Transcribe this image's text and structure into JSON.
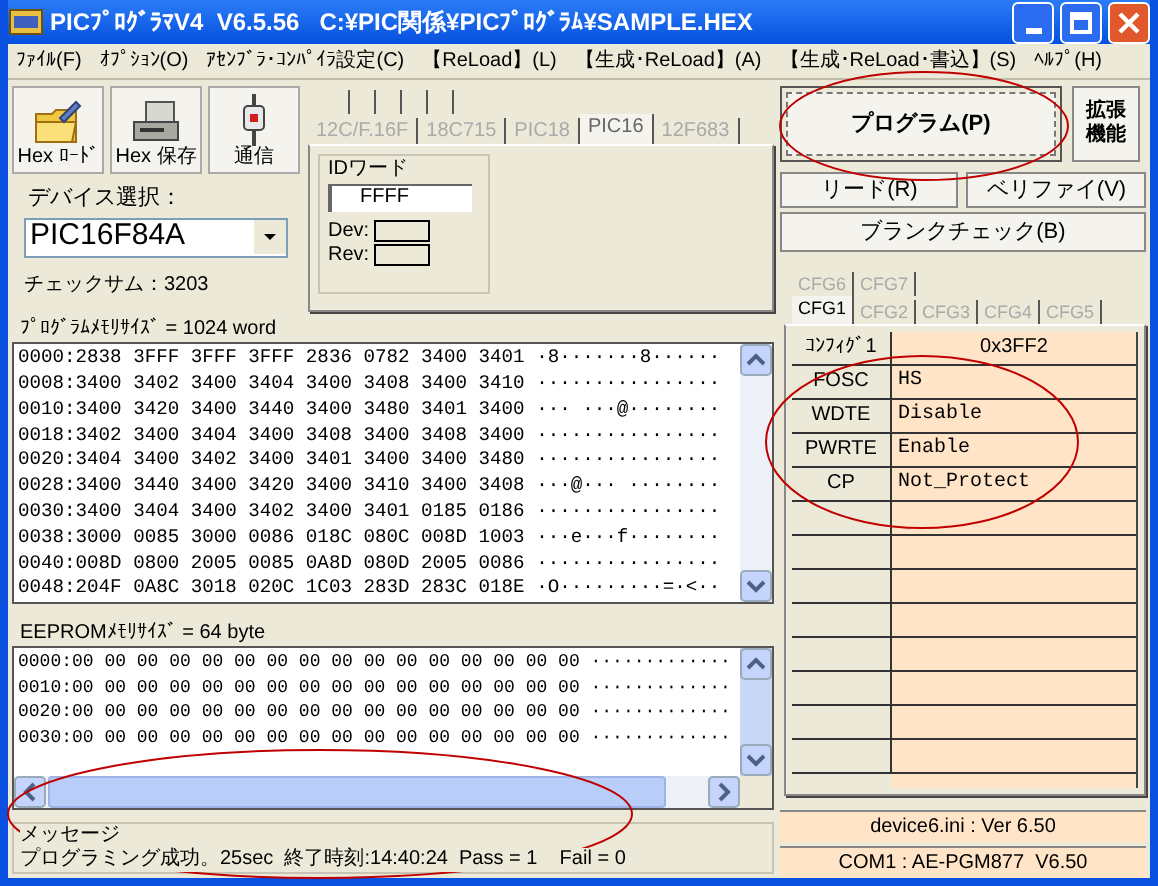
{
  "window": {
    "title": "PICﾌﾟﾛｸﾞﾗﾏV4  V6.5.56   C:¥PIC関係¥PICﾌﾟﾛｸﾞﾗﾑ¥SAMPLE.HEX"
  },
  "menu": [
    "ﾌｧｲﾙ(F)",
    "ｵﾌﾟｼｮﾝ(O)",
    "ｱｾﾝﾌﾞﾗ･ｺﾝﾊﾟｲﾗ設定(C)",
    "【ReLoad】(L)",
    "【生成･ReLoad】(A)",
    "【生成･ReLoad･書込】(S)",
    "ﾍﾙﾌﾟ(H)"
  ],
  "toolbar": [
    {
      "kind": "folder",
      "label": "Hex ﾛｰﾄﾞ"
    },
    {
      "kind": "drive",
      "label": "Hex 保存"
    },
    {
      "kind": "plug",
      "label": "通信"
    }
  ],
  "device_tabs": [
    {
      "label": "12C/F.16F",
      "selected": false
    },
    {
      "label": "18C715",
      "selected": false
    },
    {
      "label": "PIC18",
      "selected": false
    },
    {
      "label": "PIC16",
      "selected": true
    },
    {
      "label": "12F683",
      "selected": false
    }
  ],
  "id_word": {
    "label": "IDワード",
    "value": "FFFF",
    "dev_label": "Dev:",
    "rev_label": "Rev:"
  },
  "device_select": {
    "label": "デバイス選択：",
    "value": "PIC16F84A"
  },
  "checksum": "チェックサム：3203",
  "program_memory": {
    "label": "ﾌﾟﾛｸﾞﾗﾑﾒﾓﾘｻｲｽﾞ = 1024 word",
    "rows": [
      "0000:2838 3FFF 3FFF 3FFF 2836 0782 3400 3401 ·8·······8······",
      "0008:3400 3402 3400 3404 3400 3408 3400 3410 ················",
      "0010:3400 3420 3400 3440 3400 3480 3401 3400 ··· ···@········",
      "0018:3402 3400 3404 3400 3408 3400 3408 3400 ················",
      "0020:3404 3400 3402 3400 3401 3400 3400 3480 ················",
      "0028:3400 3440 3400 3420 3400 3410 3400 3408 ···@··· ········",
      "0030:3400 3404 3400 3402 3400 3401 0185 0186 ················",
      "0038:3000 0085 3000 0086 018C 080C 008D 1003 ···e···f········",
      "0040:008D 0800 2005 0085 0A8D 080D 2005 0086 ················",
      "0048:204F 0A8C 3018 020C 1C03 283D 283C 018E ·O·········=·<··"
    ]
  },
  "eeprom": {
    "label": "EEPROMﾒﾓﾘｻｲｽﾞ = 64 byte",
    "rows": [
      "0000:00 00 00 00 00 00 00 00 00 00 00 00 00 00 00 00 ·············",
      "0010:00 00 00 00 00 00 00 00 00 00 00 00 00 00 00 00 ·············",
      "0020:00 00 00 00 00 00 00 00 00 00 00 00 00 00 00 00 ·············",
      "0030:00 00 00 00 00 00 00 00 00 00 00 00 00 00 00 00 ·············"
    ]
  },
  "message": {
    "label": "メッセージ",
    "text": "プログラミング成功。25sec  終了時刻:14:40:24  Pass = 1    Fail = 0"
  },
  "actions": {
    "program": "プログラム(P)",
    "extended": "拡張機能",
    "read": "リード(R)",
    "verify": "ベリファイ(V)",
    "blank_check": "ブランクチェック(B)"
  },
  "cfg_tab_rows": [
    [
      {
        "label": "CFG6",
        "selected": false
      },
      {
        "label": "CFG7",
        "selected": false
      }
    ],
    [
      {
        "label": "CFG1",
        "selected": true
      },
      {
        "label": "CFG2",
        "selected": false
      },
      {
        "label": "CFG3",
        "selected": false
      },
      {
        "label": "CFG4",
        "selected": false
      },
      {
        "label": "CFG5",
        "selected": false
      }
    ]
  ],
  "config_table": {
    "header": [
      "ｺﾝﾌｨｸﾞ1",
      "0x3FF2"
    ],
    "rows": [
      [
        "FOSC",
        "HS"
      ],
      [
        "WDTE",
        "Disable"
      ],
      [
        "PWRTE",
        "Enable"
      ],
      [
        "CP",
        "Not_Protect"
      ]
    ]
  },
  "status": [
    "device6.ini : Ver 6.50",
    "COM1 : AE-PGM877  V6.50"
  ]
}
